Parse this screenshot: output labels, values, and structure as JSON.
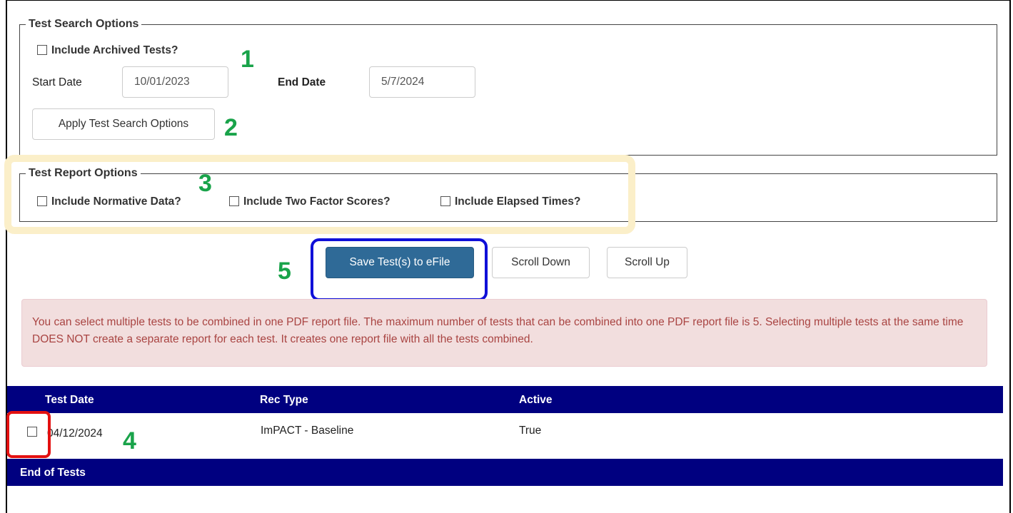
{
  "search_options": {
    "legend": "Test Search Options",
    "include_archived_label": "Include Archived Tests?",
    "start_date_label": "Start Date",
    "start_date_value": "10/01/2023",
    "end_date_label": "End Date",
    "end_date_value": "5/7/2024",
    "apply_button": "Apply Test Search Options"
  },
  "report_options": {
    "legend": "Test Report Options",
    "normative_label": "Include Normative Data?",
    "two_factor_label": "Include Two Factor Scores?",
    "elapsed_label": "Include Elapsed Times?"
  },
  "actions": {
    "save_button": "Save Test(s) to eFile",
    "scroll_down_button": "Scroll Down",
    "scroll_up_button": "Scroll Up"
  },
  "alert_text": "You can select multiple tests to be combined in one PDF report file. The maximum number of tests that can be combined into one PDF report file is 5. Selecting multiple tests at the same time DOES NOT create a separate report for each test. It creates one report file with all the tests combined.",
  "table": {
    "headers": [
      "Test Date",
      "Rec Type",
      "Active"
    ],
    "rows": [
      {
        "test_date": "04/12/2024",
        "rec_type": "ImPACT - Baseline",
        "active": "True"
      }
    ],
    "footer": "End of Tests"
  },
  "annotations": [
    "1",
    "2",
    "3",
    "4",
    "5"
  ],
  "colors": {
    "header_bar": "#000080",
    "primary_button": "#2f6a97",
    "alert_bg": "#f2dede",
    "alert_text": "#a94442",
    "annotation_green": "#19a34a",
    "highlight_yellow": "#fbefc9",
    "highlight_blue": "#1010d8",
    "highlight_red": "#e31010"
  }
}
